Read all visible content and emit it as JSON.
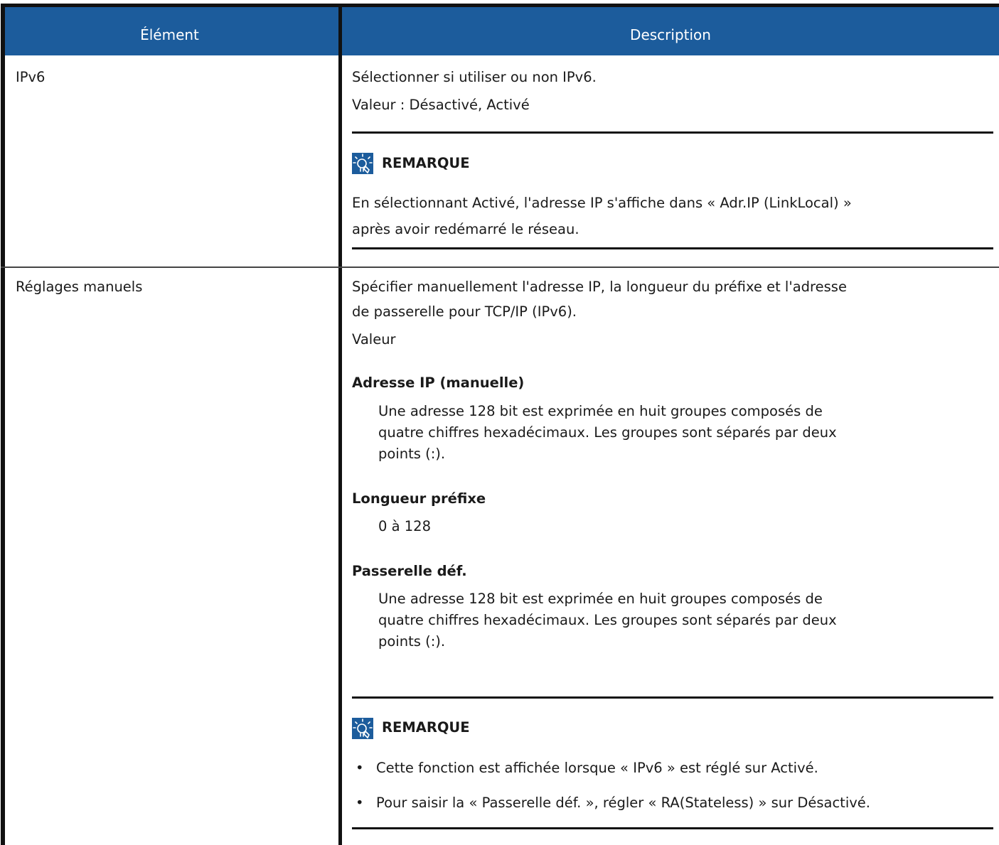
{
  "header": {
    "col1": "Élément",
    "col2": "Description"
  },
  "rows": [
    {
      "item": "IPv6",
      "desc_line1": "Sélectionner si utiliser ou non IPv6.",
      "desc_line2": "Valeur : Désactivé, Activé",
      "note": {
        "title": "REMARQUE",
        "line1": "En sélectionnant Activé, l'adresse IP s'affiche dans « Adr.IP (LinkLocal) »",
        "line2": "après avoir redémarré le réseau."
      }
    },
    {
      "item": "Réglages manuels",
      "desc_line1": "Spécifier manuellement l'adresse IP, la longueur du préfixe et l'adresse",
      "desc_line2": "de passerelle pour TCP/IP (IPv6).",
      "desc_line3": "Valeur",
      "sections": [
        {
          "heading": "Adresse IP (manuelle)",
          "line1": "Une adresse 128 bit est exprimée en huit groupes composés de",
          "line2": "quatre chiffres hexadécimaux. Les groupes sont séparés par deux",
          "line3": "points (:)."
        },
        {
          "heading": "Longueur préfixe",
          "line1": "0 à 128"
        },
        {
          "heading": "Passerelle déf.",
          "line1": "Une adresse 128 bit est exprimée en huit groupes composés de",
          "line2": "quatre chiffres hexadécimaux. Les groupes sont séparés par deux",
          "line3": "points (:)."
        }
      ],
      "note": {
        "title": "REMARQUE",
        "bullet_char": "•",
        "bullets": [
          "Cette fonction est affichée lorsque « IPv6 » est réglé sur Activé.",
          "Pour saisir la « Passerelle déf. », régler « RA(Stateless) » sur Désactivé."
        ]
      }
    }
  ],
  "colors": {
    "header_bg": "#1c5c9c",
    "header_text": "#ffffff",
    "icon_blue": "#1c5c9c"
  }
}
